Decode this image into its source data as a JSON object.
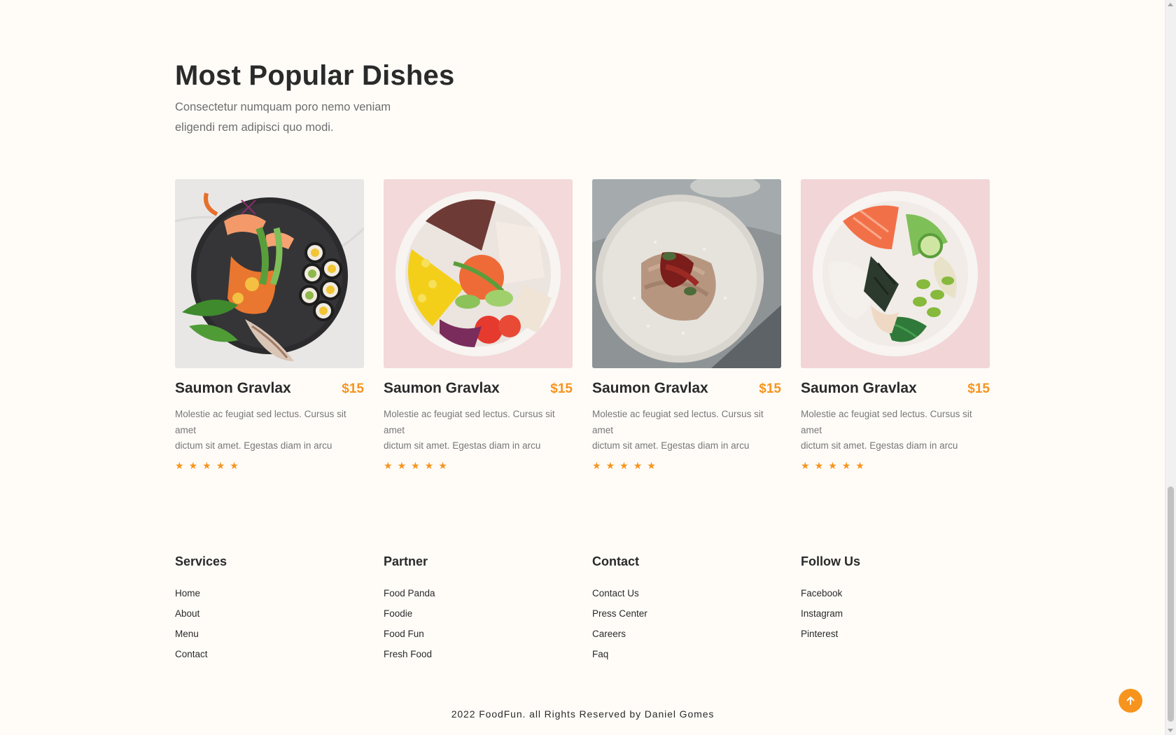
{
  "section": {
    "title": "Most Popular Dishes",
    "subtitle": "Consectetur numquam poro nemo veniam eligendi rem adipisci quo modi."
  },
  "dishes": [
    {
      "name": "Saumon Gravlax",
      "price": "$15",
      "desc_line1": "Molestie ac feugiat sed lectus. Cursus sit amet",
      "desc_line2": "dictum sit amet. Egestas diam in arcu",
      "rating": 5,
      "image": "sushi-plate"
    },
    {
      "name": "Saumon Gravlax",
      "price": "$15",
      "desc_line1": "Molestie ac feugiat sed lectus. Cursus sit amet",
      "desc_line2": "dictum sit amet. Egestas diam in arcu",
      "rating": 5,
      "image": "rice-bowl"
    },
    {
      "name": "Saumon Gravlax",
      "price": "$15",
      "desc_line1": "Molestie ac feugiat sed lectus. Cursus sit amet",
      "desc_line2": "dictum sit amet. Egestas diam in arcu",
      "rating": 5,
      "image": "pasta-plate"
    },
    {
      "name": "Saumon Gravlax",
      "price": "$15",
      "desc_line1": "Molestie ac feugiat sed lectus. Cursus sit amet",
      "desc_line2": "dictum sit amet. Egestas diam in arcu",
      "rating": 5,
      "image": "poke-bowl"
    }
  ],
  "footer": {
    "columns": [
      {
        "heading": "Services",
        "links": [
          "Home",
          "About",
          "Menu",
          "Contact"
        ]
      },
      {
        "heading": "Partner",
        "links": [
          "Food Panda",
          "Foodie",
          "Food Fun",
          "Fresh Food"
        ]
      },
      {
        "heading": "Contact",
        "links": [
          "Contact Us",
          "Press Center",
          "Careers",
          "Faq"
        ]
      },
      {
        "heading": "Follow Us",
        "links": [
          "Facebook",
          "Instagram",
          "Pinterest"
        ]
      }
    ],
    "copyright": "2022 FoodFun. all Rights Reserved by Daniel Gomes"
  },
  "colors": {
    "accent": "#f7941d",
    "background": "#fffcf8",
    "text": "#2a2a2a"
  },
  "icons": {
    "star": "star-icon",
    "back_to_top": "arrow-up-icon"
  }
}
